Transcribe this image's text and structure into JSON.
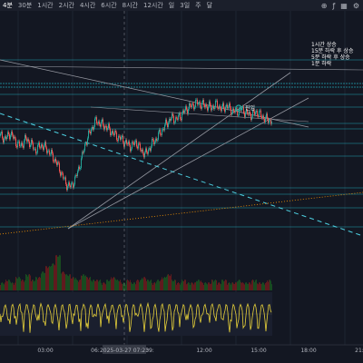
{
  "toolbar": {
    "timeframes": [
      "4분",
      "30분",
      "1시간",
      "2시간",
      "4시간",
      "6시간",
      "8시간",
      "12시간",
      "일",
      "3일",
      "주",
      "달"
    ],
    "selected_index": 0,
    "icons": [
      "compare-icon",
      "indicator-icon",
      "layout-icon",
      "settings-icon"
    ]
  },
  "notes": [
    "1시간 상승",
    "15분 하락 후 상승",
    "5분 하락 후 상승",
    "1분 하락"
  ],
  "entry_label": "진입",
  "crosshair_label": "2025-03-27  07:23",
  "colors": {
    "background": "#131722",
    "candle_up": "#26a69a",
    "candle_down": "#ef5350",
    "level_line": "#26c6da",
    "trend_line": "#9598a1",
    "dashed_line": "#4dd0e1",
    "dotted_line": "#ff9800",
    "oscillator": "#e8d23a"
  },
  "chart_data": {
    "type": "candlestick",
    "title": "",
    "x_ticks": [
      "03:00",
      "06:",
      "09:",
      "12:00",
      "15:00",
      "18:00",
      "21:"
    ],
    "price_path": [
      62,
      60,
      64,
      58,
      55,
      60,
      57,
      52,
      56,
      54,
      50,
      45,
      38,
      30,
      28,
      34,
      45,
      58,
      66,
      72,
      70,
      68,
      65,
      62,
      60,
      57,
      55,
      58,
      52,
      50,
      56,
      60,
      65,
      70,
      74,
      73,
      76,
      80,
      82,
      84,
      83,
      82,
      81,
      83,
      80,
      82,
      79,
      78,
      80,
      77,
      76,
      78,
      75,
      73,
      72
    ],
    "volume_path": [
      2,
      3,
      2,
      4,
      3,
      5,
      3,
      4,
      6,
      8,
      9,
      12,
      6,
      5,
      4,
      3,
      5,
      4,
      3,
      3,
      2,
      3,
      4,
      3,
      2,
      3,
      2,
      3,
      4,
      3,
      2,
      3,
      4,
      5,
      3,
      2,
      3,
      2,
      2,
      3,
      2,
      2,
      3,
      2,
      3,
      2,
      2,
      3,
      2,
      2,
      3,
      2,
      2,
      3,
      2
    ],
    "oscillator_seed": 7,
    "legend": "none",
    "grid": true
  }
}
